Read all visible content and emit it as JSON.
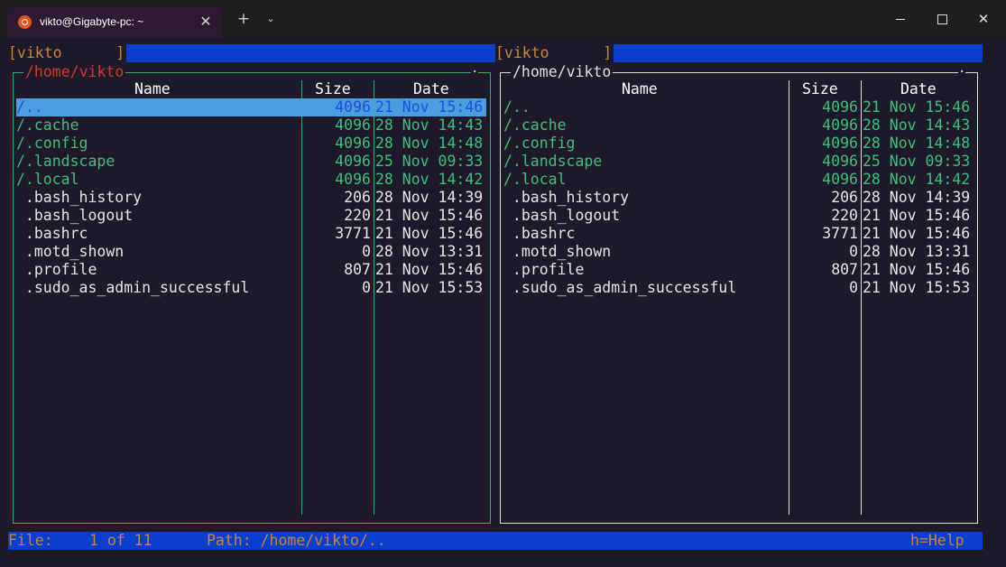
{
  "window": {
    "tab_title": "vikto@Gigabyte-pc: ~",
    "tab_close": "✕",
    "new_tab": "+",
    "dropdown": "⌄",
    "close": "✕",
    "icon": "ubuntu-icon"
  },
  "cmdline": {
    "left": "[vikto      ]",
    "right": "[vikto      ]"
  },
  "panels": {
    "left": {
      "title": "/home/vikto",
      "marker": "·",
      "headers": {
        "name": "Name",
        "size": "Size",
        "date": "Date"
      },
      "rows": [
        {
          "name": "/..",
          "size": "4096",
          "date": "21 Nov 15:46",
          "kind": "dir",
          "selected": true
        },
        {
          "name": "/.cache",
          "size": "4096",
          "date": "28 Nov 14:43",
          "kind": "dir"
        },
        {
          "name": "/.config",
          "size": "4096",
          "date": "28 Nov 14:48",
          "kind": "dir"
        },
        {
          "name": "/.landscape",
          "size": "4096",
          "date": "25 Nov 09:33",
          "kind": "dir"
        },
        {
          "name": "/.local",
          "size": "4096",
          "date": "28 Nov 14:42",
          "kind": "dir"
        },
        {
          "name": " .bash_history",
          "size": "206",
          "date": "28 Nov 14:39",
          "kind": "file"
        },
        {
          "name": " .bash_logout",
          "size": "220",
          "date": "21 Nov 15:46",
          "kind": "file"
        },
        {
          "name": " .bashrc",
          "size": "3771",
          "date": "21 Nov 15:46",
          "kind": "file"
        },
        {
          "name": " .motd_shown",
          "size": "0",
          "date": "28 Nov 13:31",
          "kind": "file"
        },
        {
          "name": " .profile",
          "size": "807",
          "date": "21 Nov 15:46",
          "kind": "file"
        },
        {
          "name": " .sudo_as_admin_successful",
          "size": "0",
          "date": "21 Nov 15:53",
          "kind": "file"
        }
      ]
    },
    "right": {
      "title": "/home/vikto",
      "marker": "·",
      "headers": {
        "name": "Name",
        "size": "Size",
        "date": "Date"
      },
      "rows": [
        {
          "name": "/..",
          "size": "4096",
          "date": "21 Nov 15:46",
          "kind": "dir"
        },
        {
          "name": "/.cache",
          "size": "4096",
          "date": "28 Nov 14:43",
          "kind": "dir"
        },
        {
          "name": "/.config",
          "size": "4096",
          "date": "28 Nov 14:48",
          "kind": "dir"
        },
        {
          "name": "/.landscape",
          "size": "4096",
          "date": "25 Nov 09:33",
          "kind": "dir"
        },
        {
          "name": "/.local",
          "size": "4096",
          "date": "28 Nov 14:42",
          "kind": "dir"
        },
        {
          "name": " .bash_history",
          "size": "206",
          "date": "28 Nov 14:39",
          "kind": "file"
        },
        {
          "name": " .bash_logout",
          "size": "220",
          "date": "21 Nov 15:46",
          "kind": "file"
        },
        {
          "name": " .bashrc",
          "size": "3771",
          "date": "21 Nov 15:46",
          "kind": "file"
        },
        {
          "name": " .motd_shown",
          "size": "0",
          "date": "28 Nov 13:31",
          "kind": "file"
        },
        {
          "name": " .profile",
          "size": "807",
          "date": "21 Nov 15:46",
          "kind": "file"
        },
        {
          "name": " .sudo_as_admin_successful",
          "size": "0",
          "date": "21 Nov 15:53",
          "kind": "file"
        }
      ]
    }
  },
  "status": {
    "file_label": "File:",
    "position": "1 of 11",
    "path_label": "Path: /home/vikto/..",
    "help": "h=Help"
  },
  "colors": {
    "terminal_bg": "#1e1a29",
    "dir": "#3fbf7e",
    "file": "#e6e6e6",
    "highlight": "#0a3ecc",
    "selection": "#4a9ee0",
    "accent": "#c8863a",
    "active_title": "#d23a2e"
  }
}
